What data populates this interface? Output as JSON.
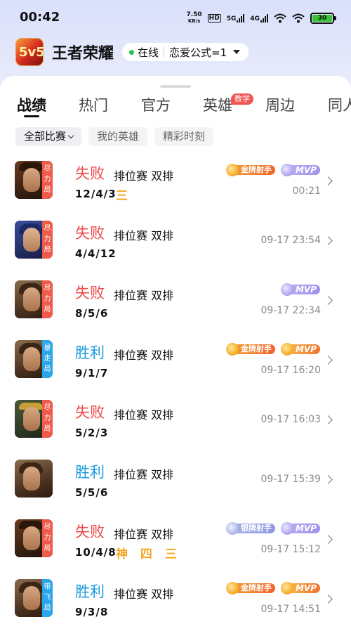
{
  "status_bar": {
    "time": "00:42",
    "net_speed_value": "7.50",
    "net_speed_unit": "KB/s",
    "hd_label": "HD",
    "net1": "5G",
    "net2": "4G",
    "battery": "30"
  },
  "header": {
    "app_icon_text": "5v5",
    "title": "王者荣耀",
    "status": "在线",
    "account": "恋爱公式=1"
  },
  "tabs": [
    {
      "label": "战绩",
      "active": true
    },
    {
      "label": "热门",
      "active": false
    },
    {
      "label": "官方",
      "active": false
    },
    {
      "label": "英雄",
      "active": false,
      "badge": "教学"
    },
    {
      "label": "周边",
      "active": false
    },
    {
      "label": "同人",
      "active": false
    }
  ],
  "filters": [
    {
      "label": "全部比赛",
      "active": true
    },
    {
      "label": "我的英雄",
      "active": false
    },
    {
      "label": "精彩时刻",
      "active": false
    }
  ],
  "matches": [
    {
      "hero": "hero-a",
      "ribbon": "尽力局",
      "ribbon_color": "red",
      "result": "失败",
      "result_type": "lose",
      "mode": "排位赛 双排",
      "kda": "12/4/3",
      "honors": "三",
      "time": "00:21",
      "tags": [
        {
          "style": "gold",
          "text": "金牌射手"
        },
        {
          "style": "mvp",
          "text": "MVP"
        }
      ]
    },
    {
      "hero": "hero-b",
      "ribbon": "尽力局",
      "ribbon_color": "red",
      "result": "失败",
      "result_type": "lose",
      "mode": "排位赛 双排",
      "kda": "4/4/12",
      "honors": "",
      "time": "09-17 23:54",
      "tags": []
    },
    {
      "hero": "hero-d",
      "ribbon": "尽力局",
      "ribbon_color": "red",
      "result": "失败",
      "result_type": "lose",
      "mode": "排位赛 双排",
      "kda": "8/5/6",
      "honors": "",
      "time": "09-17 22:34",
      "tags": [
        {
          "style": "mvp",
          "text": "MVP"
        }
      ]
    },
    {
      "hero": "hero-d",
      "ribbon": "暴走局",
      "ribbon_color": "blue",
      "result": "胜利",
      "result_type": "win",
      "mode": "排位赛 双排",
      "kda": "9/1/7",
      "honors": "",
      "time": "09-17 16:20",
      "tags": [
        {
          "style": "gold",
          "text": "金牌射手"
        },
        {
          "style": "mvp gold",
          "text": "MVP"
        }
      ]
    },
    {
      "hero": "hero-c",
      "ribbon": "尽力局",
      "ribbon_color": "red",
      "result": "失败",
      "result_type": "lose",
      "mode": "排位赛 双排",
      "kda": "5/2/3",
      "honors": "",
      "time": "09-17 16:03",
      "tags": []
    },
    {
      "hero": "hero-d",
      "ribbon": "",
      "ribbon_color": "",
      "result": "胜利",
      "result_type": "win",
      "mode": "排位赛 双排",
      "kda": "5/5/6",
      "honors": "",
      "time": "09-17 15:39",
      "tags": []
    },
    {
      "hero": "hero-a",
      "ribbon": "尽力局",
      "ribbon_color": "red",
      "result": "失败",
      "result_type": "lose",
      "mode": "排位赛 双排",
      "kda": "10/4/8",
      "honors": "神 四 三",
      "time": "09-17 15:12",
      "tags": [
        {
          "style": "silver",
          "text": "银牌射手"
        },
        {
          "style": "mvp",
          "text": "MVP"
        }
      ]
    },
    {
      "hero": "hero-d",
      "ribbon": "带飞局",
      "ribbon_color": "blue",
      "result": "胜利",
      "result_type": "win",
      "mode": "排位赛 双排",
      "kda": "9/3/8",
      "honors": "",
      "time": "09-17 14:51",
      "tags": [
        {
          "style": "gold",
          "text": "金牌射手"
        },
        {
          "style": "mvp gold",
          "text": "MVP"
        }
      ]
    }
  ]
}
